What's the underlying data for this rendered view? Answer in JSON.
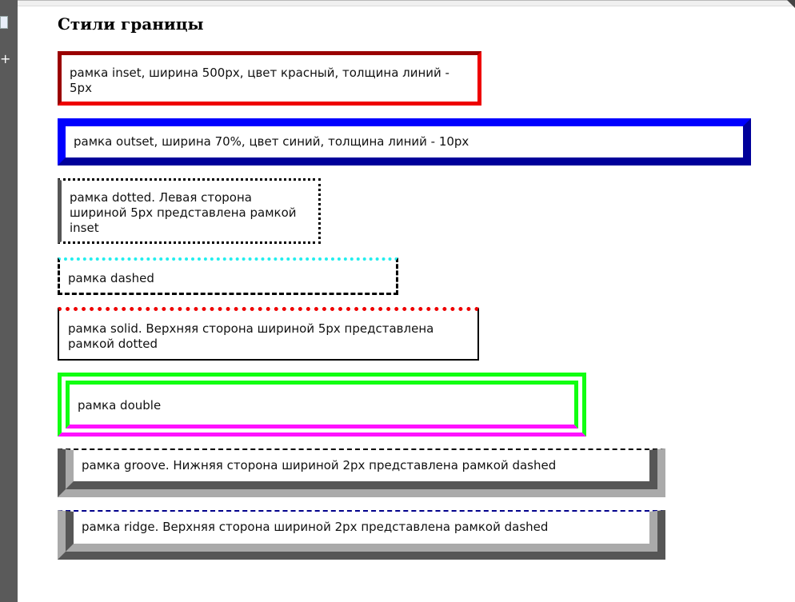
{
  "heading": "Стили границы",
  "boxes": [
    {
      "text": "рамка inset, ширина 500px, цвет красный, толщина линий - 5px"
    },
    {
      "text": "рамка outset, ширина 70%, цвет синий, толщина линий - 10px"
    },
    {
      "text": "рамка dotted. Левая сторона шириной 5px представлена рамкой inset"
    },
    {
      "text": "рамка dashed"
    },
    {
      "text": "рамка solid. Верхняя сторона шириной 5px представлена рамкой dotted"
    },
    {
      "text": "рамка double"
    },
    {
      "text": "рамка groove. Нижняя сторона шириной 2px представлена рамкой dashed"
    },
    {
      "text": "рамка ridge. Верхняя сторона шириной 2px представлена рамкой dashed"
    }
  ],
  "colors": {
    "inset_red": "#ee0000",
    "outset_blue": "#0000ee",
    "dashed_top_cyan": "#22eeee",
    "dotted_top_red": "#ee0000",
    "double_green": "#11ff11",
    "double_bottom_magenta": "#ff11ff",
    "groove_gray": "#aaaaaa",
    "ridge_top_navy": "#00008b"
  },
  "icons": {
    "sidebar_top": "document-icon",
    "sidebar_add": "plus-icon"
  }
}
